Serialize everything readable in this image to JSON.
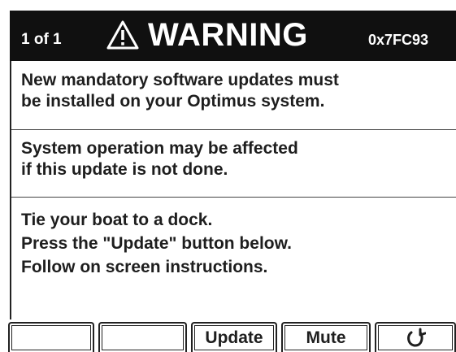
{
  "header": {
    "page_counter": "1 of 1",
    "icon": "warning-triangle-icon",
    "title": "WARNING",
    "code": "0x7FC93"
  },
  "messages": [
    {
      "lines": [
        "New mandatory software updates must",
        "be installed on your Optimus system."
      ]
    },
    {
      "lines": [
        "System operation may be affected",
        "if this update is not done."
      ]
    },
    {
      "lines": [
        "Tie your boat to a dock.",
        "Press the \"Update\" button below.",
        "Follow on screen instructions."
      ]
    }
  ],
  "softkeys": [
    {
      "label": ""
    },
    {
      "label": ""
    },
    {
      "label": "Update"
    },
    {
      "label": "Mute"
    },
    {
      "label": "",
      "icon": "back-arrow-icon"
    }
  ],
  "colors": {
    "header_background": "#101010",
    "header_text": "#ffffff",
    "body_text": "#1e1e1e",
    "background": "#ffffff"
  }
}
